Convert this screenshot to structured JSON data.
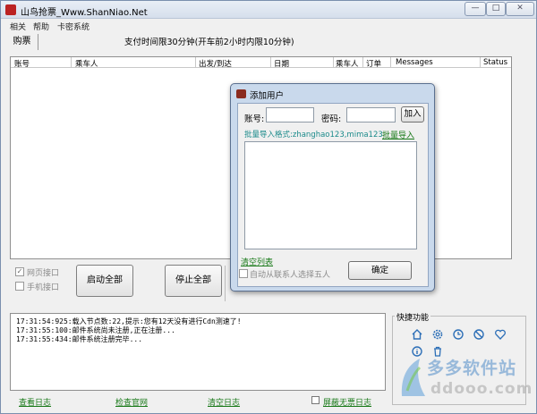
{
  "window": {
    "title": "山鸟抢票_Www.ShanNiao.Net",
    "controls": {
      "minimize": "—",
      "maximize": "□",
      "close": "✕"
    }
  },
  "menu": [
    "相关",
    "帮助",
    "卡密系统"
  ],
  "tabs": {
    "purchase": "购票"
  },
  "notice": "支付时间限30分钟(开车前2小时内限10分钟)",
  "table": {
    "columns": [
      "账号",
      "乘车人",
      "出发/到达",
      "日期",
      "乘车人",
      "订单",
      "Messages",
      "Status"
    ]
  },
  "options": {
    "web_port": "网页接口",
    "mobile_port": "手机接口"
  },
  "buttons": {
    "start_all": "启动全部",
    "stop_all": "停止全部"
  },
  "log": {
    "lines": [
      "17:31:54:925:载入节点数:22,提示:您有12天没有进行Cdn测速了!",
      "17:31:55:100:邮件系统尚未注册,正在注册...",
      "17:31:55:434:邮件系统注册完毕..."
    ]
  },
  "quick": {
    "title": "快捷功能",
    "icons": [
      "home-icon",
      "gear-icon",
      "clock-icon",
      "block-icon",
      "heart-icon",
      "info-icon",
      "trash-icon"
    ]
  },
  "footer": {
    "view_log": "查看日志",
    "check_site": "检查官网",
    "clear_log": "清空日志",
    "block_no_ticket_log": "屏蔽无票日志"
  },
  "watermark": {
    "brand": "多多软件站",
    "url": "ddooo.com"
  },
  "dialog": {
    "title": "添加用户",
    "account_label": "账号:",
    "password_label": "密码:",
    "add_button": "加入",
    "import_hint": "批量导入格式:zhanghao123,mima123",
    "import_link": "批量导入",
    "clear_list": "清空列表",
    "auto_select_label": "自动从联系人选择五人",
    "confirm_button": "确定"
  },
  "colors": {
    "link": "#1a7a1a",
    "hint": "#1a8a8a",
    "dialog_frame": "#c9d9ec"
  }
}
